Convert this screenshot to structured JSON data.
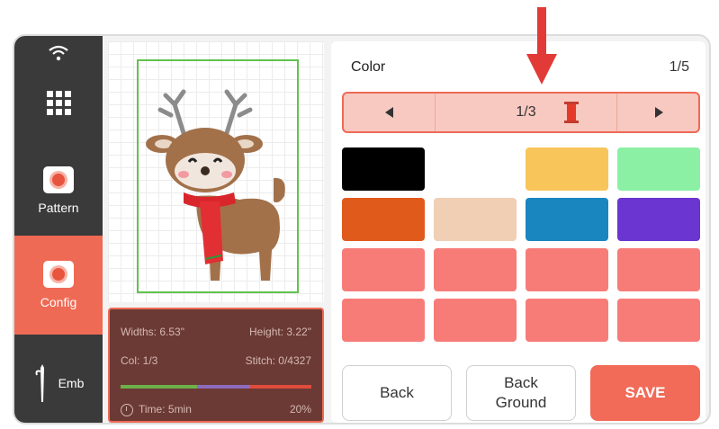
{
  "sidebar": {
    "items": [
      {
        "label": "Pattern",
        "icon": "pattern-icon"
      },
      {
        "label": "Config",
        "icon": "config-icon",
        "active": true
      },
      {
        "label": "Emb",
        "icon": "needle-icon"
      }
    ],
    "active_color": "#ef6a55"
  },
  "info": {
    "widths_label": "Widths: 6.53\"",
    "height_label": "Height: 3.22\"",
    "col_label": "Col: 1/3",
    "stitch_label": "Stitch: 0/4327",
    "time_label": "Time: 5min",
    "percent_label": "20%",
    "progress_colors": [
      "#6cb04a",
      "#8e6bbd",
      "#e04b3b"
    ]
  },
  "color_panel": {
    "title": "Color",
    "page": "1/5",
    "nav_label": "1/3",
    "swatches": [
      "#000000",
      "#ffffff",
      "#f8c55a",
      "#8cf0a4",
      "#e05a1c",
      "#f0cfb4",
      "#1a86c0",
      "#6a35d0",
      "#f77c78",
      "#f77c78",
      "#f77c78",
      "#f77c78",
      "#f77c78",
      "#f77c78",
      "#f77c78",
      "#f77c78"
    ]
  },
  "buttons": {
    "back": "Back",
    "background_line1": "Back",
    "background_line2": "Ground",
    "save": "SAVE"
  }
}
